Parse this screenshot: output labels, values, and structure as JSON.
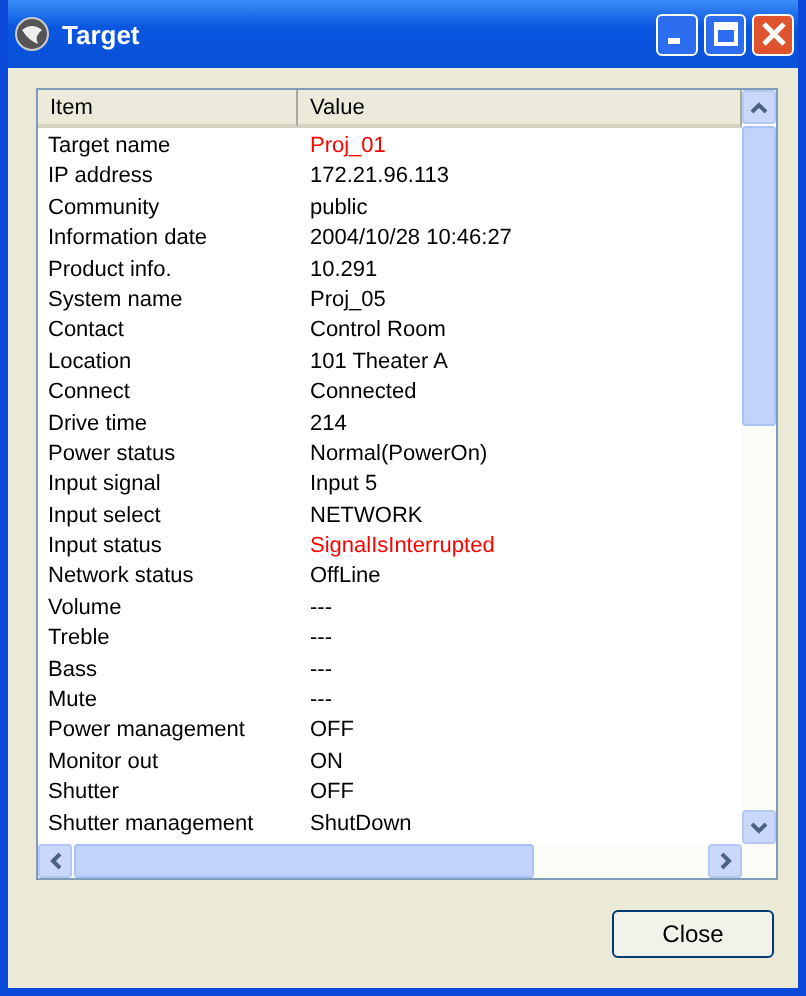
{
  "window": {
    "title": "Target"
  },
  "table": {
    "columns": [
      "Item",
      "Value"
    ],
    "rows": [
      {
        "item": "Target name",
        "value": "Proj_01",
        "alert": true
      },
      {
        "item": "IP address",
        "value": "172.21.96.113",
        "alert": false
      },
      {
        "item": "Community",
        "value": "public",
        "alert": false
      },
      {
        "item": "Information date",
        "value": "2004/10/28 10:46:27",
        "alert": false
      },
      {
        "item": "Product info.",
        "value": "10.291",
        "alert": false
      },
      {
        "item": "System name",
        "value": "Proj_05",
        "alert": false
      },
      {
        "item": "Contact",
        "value": "Control Room",
        "alert": false
      },
      {
        "item": "Location",
        "value": "101 Theater A",
        "alert": false
      },
      {
        "item": "Connect",
        "value": "Connected",
        "alert": false
      },
      {
        "item": "Drive time",
        "value": "214",
        "alert": false
      },
      {
        "item": "Power status",
        "value": "Normal(PowerOn)",
        "alert": false
      },
      {
        "item": "Input signal",
        "value": "Input 5",
        "alert": false
      },
      {
        "item": "Input select",
        "value": "NETWORK",
        "alert": false
      },
      {
        "item": "Input status",
        "value": "SignalIsInterrupted",
        "alert": true
      },
      {
        "item": "Network status",
        "value": "OffLine",
        "alert": false
      },
      {
        "item": "Volume",
        "value": "---",
        "alert": false
      },
      {
        "item": "Treble",
        "value": "---",
        "alert": false
      },
      {
        "item": "Bass",
        "value": "---",
        "alert": false
      },
      {
        "item": "Mute",
        "value": "---",
        "alert": false
      },
      {
        "item": "Power management",
        "value": "OFF",
        "alert": false
      },
      {
        "item": "Monitor out",
        "value": "ON",
        "alert": false
      },
      {
        "item": "Shutter",
        "value": "OFF",
        "alert": false
      },
      {
        "item": "Shutter management",
        "value": "ShutDown",
        "alert": false
      }
    ]
  },
  "buttons": [
    "Close"
  ]
}
